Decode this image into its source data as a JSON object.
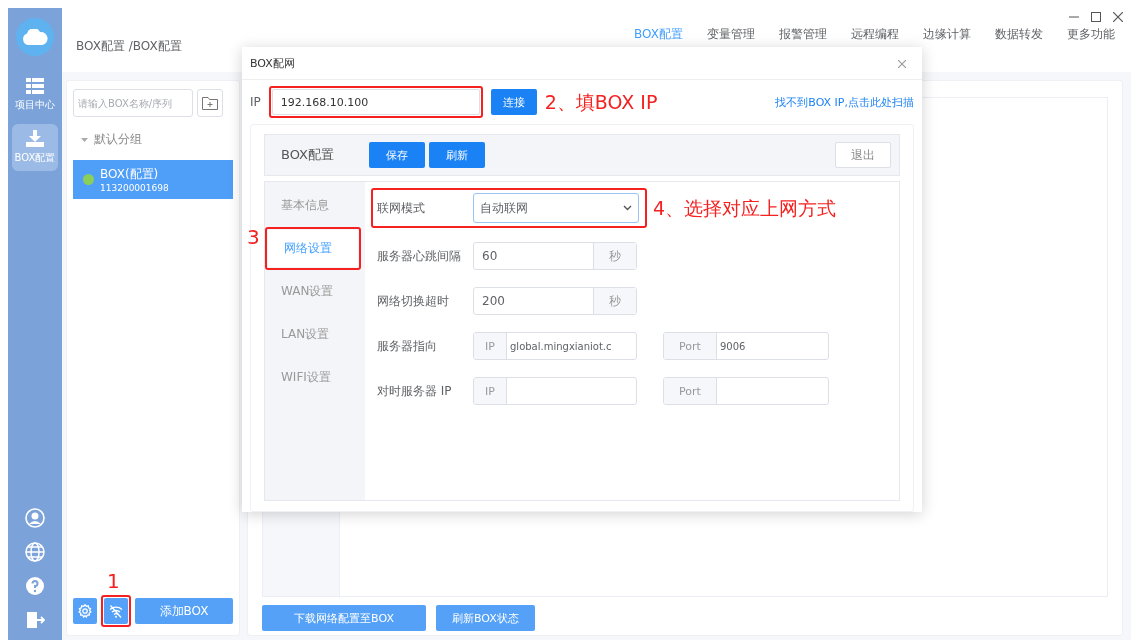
{
  "rail": {
    "items": [
      {
        "label": "项目中心",
        "selected": false
      },
      {
        "label": "BOX配置",
        "selected": true
      }
    ]
  },
  "header": {
    "breadcrumb": "BOX配置 /BOX配置",
    "nav": [
      {
        "label": "BOX配置",
        "selected": true
      },
      {
        "label": "变量管理",
        "selected": false
      },
      {
        "label": "报警管理",
        "selected": false
      },
      {
        "label": "远程编程",
        "selected": false
      },
      {
        "label": "边缘计算",
        "selected": false
      },
      {
        "label": "数据转发",
        "selected": false
      },
      {
        "label": "更多功能",
        "selected": false
      }
    ]
  },
  "box_list": {
    "search": {
      "placeholder": "请输入BOX名称/序列"
    },
    "group": {
      "label": "默认分组",
      "expanded": true,
      "items": [
        {
          "name": "BOX(配置)",
          "serial": "113200001698",
          "online": true,
          "selected": true
        }
      ]
    },
    "add_button": "添加BOX",
    "network_button": {
      "highlighted": true,
      "annotation": "1"
    }
  },
  "footer_buttons": [
    "下载网络配置至BOX",
    "刷新BOX状态"
  ],
  "dialog": {
    "title": "BOX配网",
    "ip": {
      "label": "IP",
      "value": "192.168.10.100",
      "highlighted": true
    },
    "connect_button": "连接",
    "ip_annotation": "2、填BOX IP",
    "scan_link": "找不到BOX IP,点击此处扫描",
    "panel": {
      "title": "BOX配置",
      "buttons": [
        "保存",
        "刷新"
      ],
      "exit_button": "退出",
      "tabs": [
        {
          "label": "基本信息",
          "selected": false,
          "highlighted": false
        },
        {
          "label": "网络设置",
          "selected": true,
          "highlighted": true,
          "annotation": "3"
        },
        {
          "label": "WAN设置",
          "selected": false,
          "highlighted": false
        },
        {
          "label": "LAN设置",
          "selected": false,
          "highlighted": false
        },
        {
          "label": "WIFI设置",
          "selected": false,
          "highlighted": false
        }
      ],
      "fields": [
        {
          "kind": "select",
          "label": "联网模式",
          "value": "自动联网",
          "highlighted": true,
          "annotation": "4、选择对应上网方式"
        },
        {
          "kind": "unit",
          "label": "服务器心跳间隔",
          "value": "60",
          "unit": "秒"
        },
        {
          "kind": "unit",
          "label": "网络切换超时",
          "value": "200",
          "unit": "秒"
        },
        {
          "kind": "address",
          "label": "服务器指向",
          "ip_label": "IP",
          "ip_value": "global.mingxianiot.c",
          "port_label": "Port",
          "port_value": "9006"
        },
        {
          "kind": "address",
          "label": "对时服务器 IP",
          "ip_label": "IP",
          "port_label": "Port"
        }
      ]
    }
  }
}
